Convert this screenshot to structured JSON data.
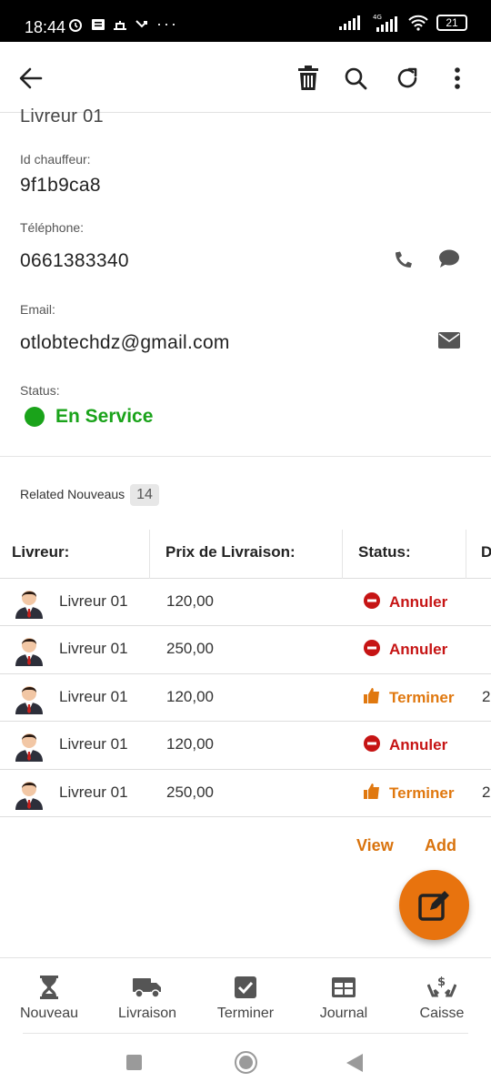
{
  "status_bar": {
    "time": "18:44",
    "battery": "21",
    "network": "4G"
  },
  "appbar": {
    "back_icon": "arrow-left-icon",
    "icons": [
      "trash-icon",
      "search-icon",
      "refresh-icon",
      "more-vert-icon"
    ]
  },
  "driver": {
    "name_partial": "Livreur 01",
    "id_label": "Id chauffeur:",
    "id_value": "9f1b9ca8",
    "phone_label": "Téléphone:",
    "phone_value": "0661383340",
    "email_label": "Email:",
    "email_value": "otlobtechdz@gmail.com",
    "status_label": "Status:",
    "status_value": "En Service",
    "status_color": "#1aa31a"
  },
  "related": {
    "label": "Related Nouveaus",
    "count": "14"
  },
  "table": {
    "headers": [
      "Livreur:",
      "Prix de Livraison:",
      "Status:",
      "D"
    ],
    "rows": [
      {
        "livreur": "Livreur 01",
        "prix": "120,00",
        "status": "Annuler",
        "status_type": "cancel",
        "extra": ""
      },
      {
        "livreur": "Livreur 01",
        "prix": "250,00",
        "status": "Annuler",
        "status_type": "cancel",
        "extra": ""
      },
      {
        "livreur": "Livreur 01",
        "prix": "120,00",
        "status": "Terminer",
        "status_type": "done",
        "extra": "2"
      },
      {
        "livreur": "Livreur 01",
        "prix": "120,00",
        "status": "Annuler",
        "status_type": "cancel",
        "extra": ""
      },
      {
        "livreur": "Livreur 01",
        "prix": "250,00",
        "status": "Terminer",
        "status_type": "done",
        "extra": "2"
      }
    ]
  },
  "actions": {
    "view": "View",
    "add": "Add"
  },
  "colors": {
    "accent": "#d9730d",
    "cancel": "#c61414",
    "done": "#e0780f",
    "fab": "#e8730e"
  },
  "bottom_nav": [
    {
      "label": "Nouveau",
      "icon": "hourglass-icon"
    },
    {
      "label": "Livraison",
      "icon": "truck-icon"
    },
    {
      "label": "Terminer",
      "icon": "check-box-icon"
    },
    {
      "label": "Journal",
      "icon": "table-icon"
    },
    {
      "label": "Caisse",
      "icon": "money-hands-icon"
    }
  ]
}
